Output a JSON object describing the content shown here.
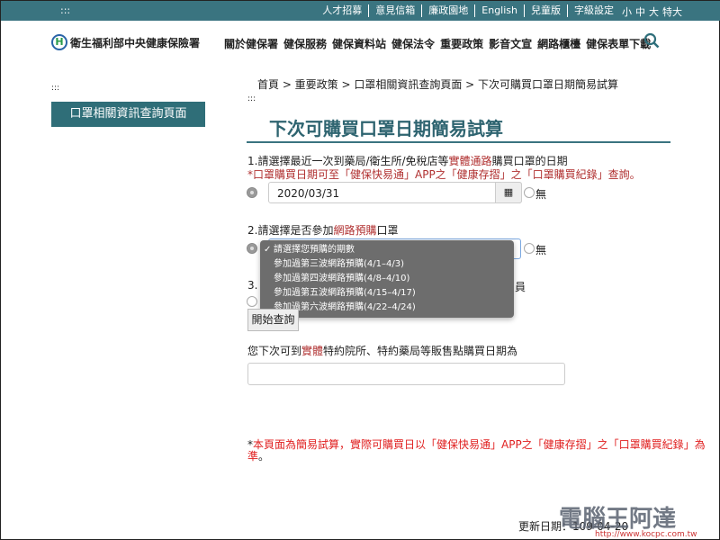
{
  "topbar": {
    "dots": ":::",
    "links": [
      "人才招募",
      "意見信箱",
      "廉政園地",
      "English",
      "兒童版",
      "字級設定"
    ],
    "font_sizes": [
      "小",
      "中",
      "大",
      "特大"
    ]
  },
  "header": {
    "logo_text": "衛生福利部中央健康保險署",
    "logo_mark": "H",
    "nav": [
      "關於健保署",
      "健保服務",
      "健保資料站",
      "健保法令",
      "重要政策",
      "影音文宣",
      "網路櫃檯",
      "健保表單下載"
    ],
    "search_icon": "search-icon"
  },
  "breadcrumb": "首頁 > 重要政策 > 口罩相關資訊查詢頁面 > 下次可購買口罩日期簡易試算",
  "sidebar": {
    "dots": ":::",
    "item": "口罩相關資訊查詢頁面"
  },
  "main": {
    "dots": ":::",
    "title": "下次可購買口罩日期簡易試算",
    "q1": {
      "pre": "1.請選擇最近一次到藥局/衛生所/免稅店等",
      "hl": "實體通路",
      "post": "購買口罩的日期",
      "note": "*口罩購買日期可至「健保快易通」APP之「健康存摺」之「口罩購買紀錄」查詢。",
      "date": "2020/03/31",
      "none": "無"
    },
    "q2": {
      "pre": "2.請選擇是否參加",
      "hl": "網路預購",
      "post": "口罩",
      "none": "無",
      "options": [
        "請選擇您預購的期數",
        "參加過第三波網路預購(4/1–4/3)",
        "參加過第四波網路預購(4/8–4/10)",
        "參加過第五波網路預購(4/15–4/17)",
        "參加過第六波網路預購(4/22–4/24)"
      ],
      "selected": 0
    },
    "q3": {
      "pre": "3.",
      "post": "員"
    },
    "submit": "開始查詢",
    "result": {
      "pre": "您下次可到",
      "hl": "實體",
      "post": "特約院所、特約藥局等販售點購買日期為",
      "value": ""
    },
    "disclaimer": {
      "ast": "*",
      "text": "本頁面為簡易試算，實際可購買日以「健保快易通」APP之「健康存摺」之「口罩購買紀錄」為準",
      "end": "。"
    },
    "updated": "更新日期：109-04-20"
  },
  "watermark": {
    "text": "電腦王阿達",
    "url": "http://www.kocpc.com.tw"
  },
  "colors": {
    "teal": "#3a7480",
    "highlight": "#b03030",
    "warning": "#e02020"
  }
}
